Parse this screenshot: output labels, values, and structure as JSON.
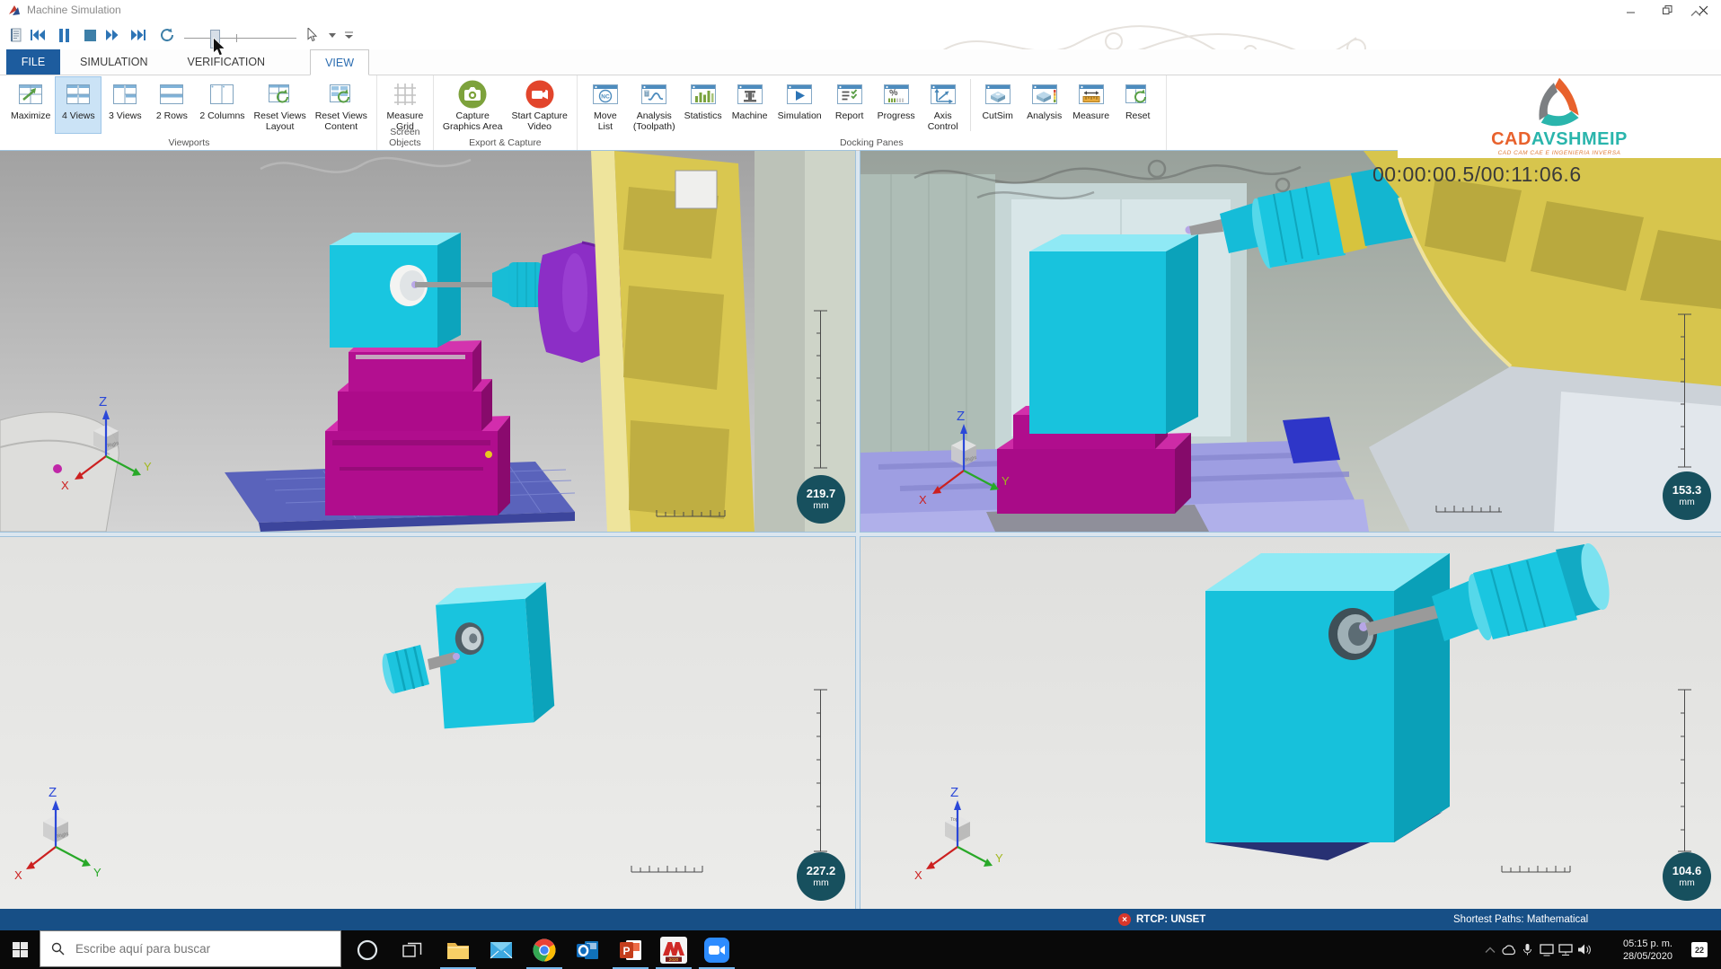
{
  "window": {
    "title": "Machine Simulation"
  },
  "playback": {
    "slider_pct": 23
  },
  "toolbar": {
    "buttons": [
      {
        "icon": "notes",
        "name": "nc-program-button"
      },
      {
        "icon": "rewind",
        "name": "rewind-button"
      },
      {
        "icon": "pause",
        "name": "pause-button"
      },
      {
        "icon": "stop",
        "name": "stop-button"
      },
      {
        "icon": "ffwd",
        "name": "fast-forward-button"
      },
      {
        "icon": "skipend",
        "name": "skip-to-end-button"
      },
      {
        "icon": "loop",
        "name": "loop-button"
      },
      {
        "icon": "pointer",
        "name": "pointer-mode-button"
      },
      {
        "icon": "caret",
        "name": "pointer-dropdown"
      },
      {
        "icon": "flyout",
        "name": "toolbar-options-button"
      }
    ]
  },
  "tabs": [
    {
      "label": "FILE",
      "style": "file"
    },
    {
      "label": "SIMULATION",
      "style": "plain"
    },
    {
      "label": "VERIFICATION",
      "style": "plain"
    },
    {
      "label": "VIEW",
      "style": "active"
    }
  ],
  "ribbon": {
    "groups": [
      {
        "label": "Viewports",
        "buttons": [
          {
            "label1": "Maximize",
            "label2": "",
            "icon": "maximize"
          },
          {
            "label1": "4 Views",
            "label2": "",
            "icon": "views4",
            "selected": true
          },
          {
            "label1": "3 Views",
            "label2": "",
            "icon": "views3"
          },
          {
            "label1": "2 Rows",
            "label2": "",
            "icon": "rows2"
          },
          {
            "label1": "2 Columns",
            "label2": "",
            "icon": "cols2"
          },
          {
            "label1": "Reset Views",
            "label2": "Layout",
            "icon": "resetLayout"
          },
          {
            "label1": "Reset Views",
            "label2": "Content",
            "icon": "resetContent"
          }
        ]
      },
      {
        "label": "Screen Objects",
        "buttons": [
          {
            "label1": "Measure",
            "label2": "Grid",
            "icon": "grid"
          }
        ]
      },
      {
        "label": "Export & Capture",
        "buttons": [
          {
            "label1": "Capture",
            "label2": "Graphics Area",
            "icon": "cameraGreen"
          },
          {
            "label1": "Start Capture",
            "label2": "Video",
            "icon": "videoRed"
          }
        ]
      },
      {
        "label": "Docking Panes",
        "buttons": [
          {
            "label1": "Move",
            "label2": "List",
            "icon": "nc"
          },
          {
            "label1": "Analysis",
            "label2": "(Toolpath)",
            "icon": "toolpath"
          },
          {
            "label1": "Statistics",
            "label2": "",
            "icon": "stats"
          },
          {
            "label1": "Machine",
            "label2": "",
            "icon": "machine"
          },
          {
            "label1": "Simulation",
            "label2": "",
            "icon": "play"
          },
          {
            "label1": "Report",
            "label2": "",
            "icon": "report"
          },
          {
            "label1": "Progress",
            "label2": "",
            "icon": "progress"
          },
          {
            "label1": "Axis",
            "label2": "Control",
            "icon": "axis",
            "divider_after": true
          },
          {
            "label1": "CutSim",
            "label2": "",
            "icon": "cutsim"
          },
          {
            "label1": "Analysis",
            "label2": "",
            "icon": "analysis3d"
          },
          {
            "label1": "Measure",
            "label2": "",
            "icon": "measureRuler"
          },
          {
            "label1": "Reset",
            "label2": "",
            "icon": "resetWin"
          }
        ]
      }
    ]
  },
  "brand": {
    "logo_text_1": "CAD",
    "logo_text_2": "AVSHMEIP",
    "tagline": "CAD CAM CAE E INGENIERIA INVERSA"
  },
  "viewports": {
    "timer": "00:00:00.5/00:11:06.6",
    "axis_labels": {
      "x": "X",
      "y": "Y",
      "z": "Z"
    },
    "cube_labels": {
      "right": "Right",
      "top": "Top"
    },
    "top_left": {
      "measure_value": "219.7",
      "measure_unit": "mm"
    },
    "top_right": {
      "measure_value": "153.3",
      "measure_unit": "mm"
    },
    "bottom_left": {
      "measure_value": "227.2",
      "measure_unit": "mm"
    },
    "bottom_right": {
      "measure_value": "104.6",
      "measure_unit": "mm"
    }
  },
  "status_bar": {
    "rtcp": "RTCP: UNSET",
    "shortest_paths": "Shortest Paths: Mathematical"
  },
  "taskbar": {
    "search_placeholder": "Escribe aquí para buscar",
    "apps": [
      {
        "icon": "folder",
        "name": "file-explorer",
        "active": true
      },
      {
        "icon": "mail",
        "name": "mail",
        "active": false
      },
      {
        "icon": "chrome",
        "name": "chrome",
        "active": true
      },
      {
        "icon": "outlook",
        "name": "outlook",
        "active": false
      },
      {
        "icon": "ppt",
        "name": "powerpoint",
        "active": true
      },
      {
        "icon": "mcam",
        "name": "mastercam-2020",
        "active": true
      },
      {
        "icon": "zoomapp",
        "name": "zoom",
        "active": true
      }
    ],
    "tray": [
      {
        "icon": "chevup",
        "name": "hidden-icons"
      },
      {
        "icon": "cloud",
        "name": "onedrive"
      },
      {
        "icon": "mic",
        "name": "microphone"
      },
      {
        "icon": "cast",
        "name": "display"
      },
      {
        "icon": "net",
        "name": "network"
      },
      {
        "icon": "vol",
        "name": "volume"
      }
    ],
    "time": "05:15 p. m.",
    "date": "28/05/2020",
    "notification_count": "22"
  },
  "colors": {
    "accent_blue": "#2d74b5",
    "tab_file_bg": "#1d5c9e",
    "selected_button_bg": "#cbe3f6",
    "badge_bg": "#17505e",
    "status_bar_bg": "#174f86",
    "error_red": "#d8372b",
    "capture_green": "#7aa33e",
    "record_red": "#e2452c",
    "brand_orange": "#e8622d",
    "brand_teal": "#2ab5ac",
    "part_cyan": "#19c5df",
    "part_magenta": "#b00d8d",
    "tool_purple": "#8c2ec6",
    "machine_yellow": "#d9c750",
    "table_blue": "#5a63bb"
  }
}
